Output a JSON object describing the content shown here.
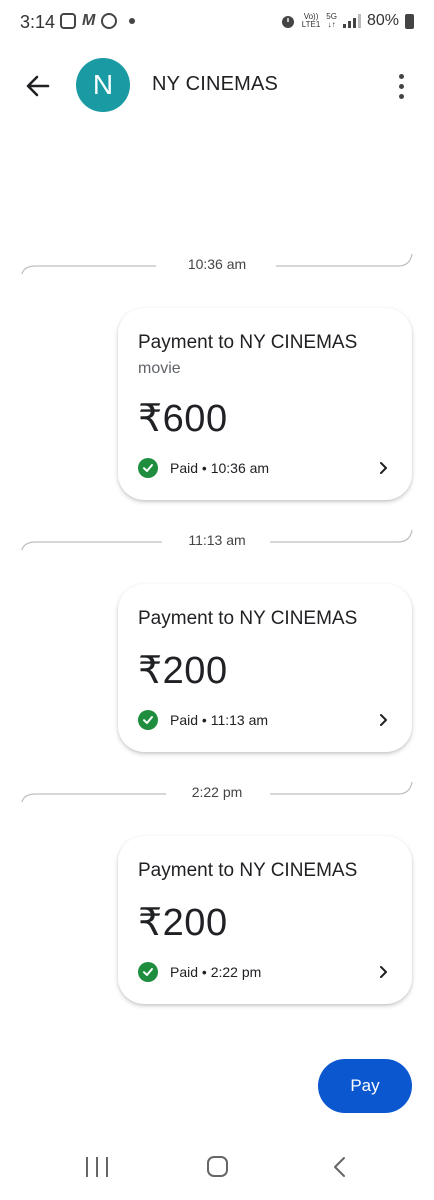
{
  "status_bar": {
    "time": "3:14",
    "network_top": "Vo))",
    "network_bottom": "LTE1",
    "gen_top": "5G",
    "gen_bottom": "↓↑",
    "battery": "80%",
    "icons": [
      "instagram-icon",
      "m-app-icon",
      "b-app-icon",
      "notification-dot-icon",
      "alarm-icon",
      "signal-icon",
      "battery-icon"
    ]
  },
  "header": {
    "avatar_letter": "N",
    "avatar_color": "#1a9ba3",
    "title": "NY CINEMAS"
  },
  "transactions": [
    {
      "divider_time": "10:36 am",
      "title": "Payment to NY CINEMAS",
      "note": "movie",
      "amount": "₹600",
      "status": "Paid • 10:36 am"
    },
    {
      "divider_time": "11:13 am",
      "title": "Payment to NY CINEMAS",
      "note": "",
      "amount": "₹200",
      "status": "Paid • 11:13 am"
    },
    {
      "divider_time": "2:22 pm",
      "title": "Payment to NY CINEMAS",
      "note": "",
      "amount": "₹200",
      "status": "Paid • 2:22 pm"
    }
  ],
  "pay_button": {
    "label": "Pay",
    "color": "#0b57d0"
  },
  "colors": {
    "paid_check": "#1e8e3e"
  }
}
